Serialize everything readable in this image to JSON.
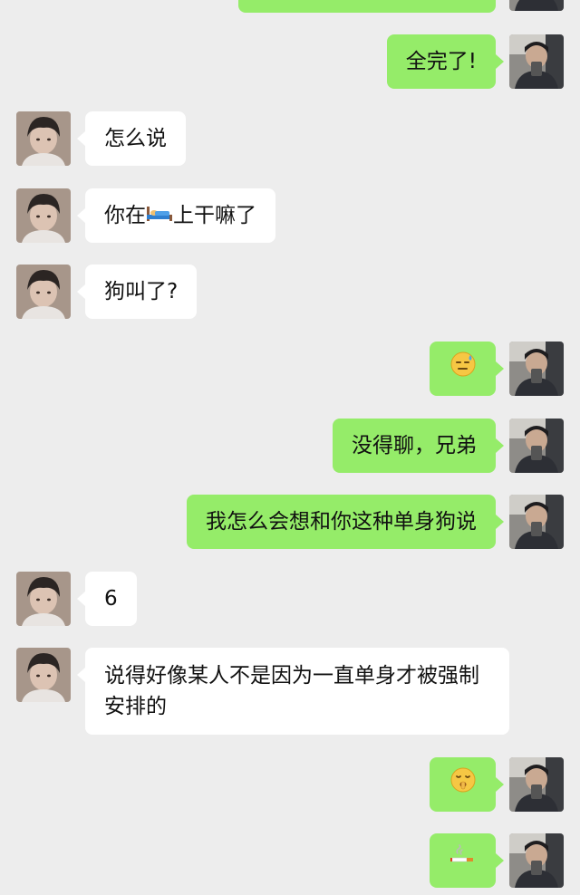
{
  "app": {
    "background": "#ededed",
    "sent_bubble_color": "#95ec69",
    "received_bubble_color": "#ffffff"
  },
  "messages": [
    {
      "side": "out",
      "text": ""
    },
    {
      "side": "out",
      "text": "全完了!"
    },
    {
      "side": "in",
      "text": "怎么说"
    },
    {
      "side": "in",
      "text_before": "你在",
      "emoji": "bed-emoji",
      "text_after": "上干嘛了"
    },
    {
      "side": "in",
      "text": "狗叫了?"
    },
    {
      "side": "out",
      "emoji": "sweat-face-emoji"
    },
    {
      "side": "out",
      "text": "没得聊，兄弟"
    },
    {
      "side": "out",
      "text": "我怎么会想和你这种单身狗说"
    },
    {
      "side": "in",
      "text": "6"
    },
    {
      "side": "in",
      "text": "说得好像某人不是因为一直单身才被强制安排的"
    },
    {
      "side": "out",
      "emoji": "shushing-face-emoji"
    },
    {
      "side": "out",
      "emoji": "cigarette-emoji"
    }
  ]
}
